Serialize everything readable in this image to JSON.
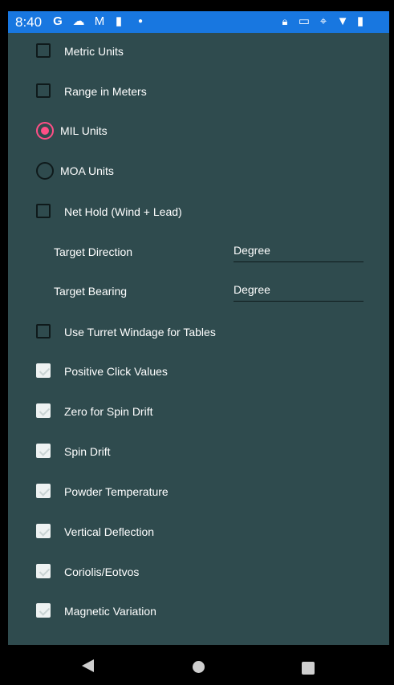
{
  "status_bar": {
    "time": "8:40",
    "icons_left": [
      "google-icon",
      "cloud-upload-icon",
      "gmail-icon",
      "bottle-icon",
      "dot-icon"
    ],
    "icons_right": [
      "lock-icon",
      "cast-icon",
      "location-icon",
      "wifi-icon",
      "battery-icon"
    ]
  },
  "settings": {
    "metric_units": {
      "label": "Metric Units",
      "checked": false
    },
    "range_in_meters": {
      "label": "Range in Meters",
      "checked": false
    },
    "mil_units": {
      "label": "MIL Units",
      "selected": true
    },
    "moa_units": {
      "label": "MOA Units",
      "selected": false
    },
    "net_hold": {
      "label": "Net Hold (Wind + Lead)",
      "checked": false
    },
    "target_direction": {
      "label": "Target Direction",
      "value": "Degree"
    },
    "target_bearing": {
      "label": "Target Bearing",
      "value": "Degree"
    },
    "turret_windage": {
      "label": "Use Turret Windage for Tables",
      "checked": false
    },
    "positive_click": {
      "label": "Positive Click Values",
      "checked": true
    },
    "zero_spin_drift": {
      "label": "Zero for Spin Drift",
      "checked": true
    },
    "spin_drift": {
      "label": "Spin Drift",
      "checked": true
    },
    "powder_temperature": {
      "label": "Powder Temperature",
      "checked": true
    },
    "vertical_deflection": {
      "label": "Vertical Deflection",
      "checked": true
    },
    "coriolis": {
      "label": "Coriolis/Eotvos",
      "checked": true
    },
    "magnetic_variation": {
      "label": "Magnetic Variation",
      "checked": true
    }
  },
  "colors": {
    "status_bar": "#1877e0",
    "background": "#2f4b4e",
    "radio_accent": "#ff4f86"
  },
  "nav_bar": [
    "back-icon",
    "home-icon",
    "recents-icon"
  ]
}
